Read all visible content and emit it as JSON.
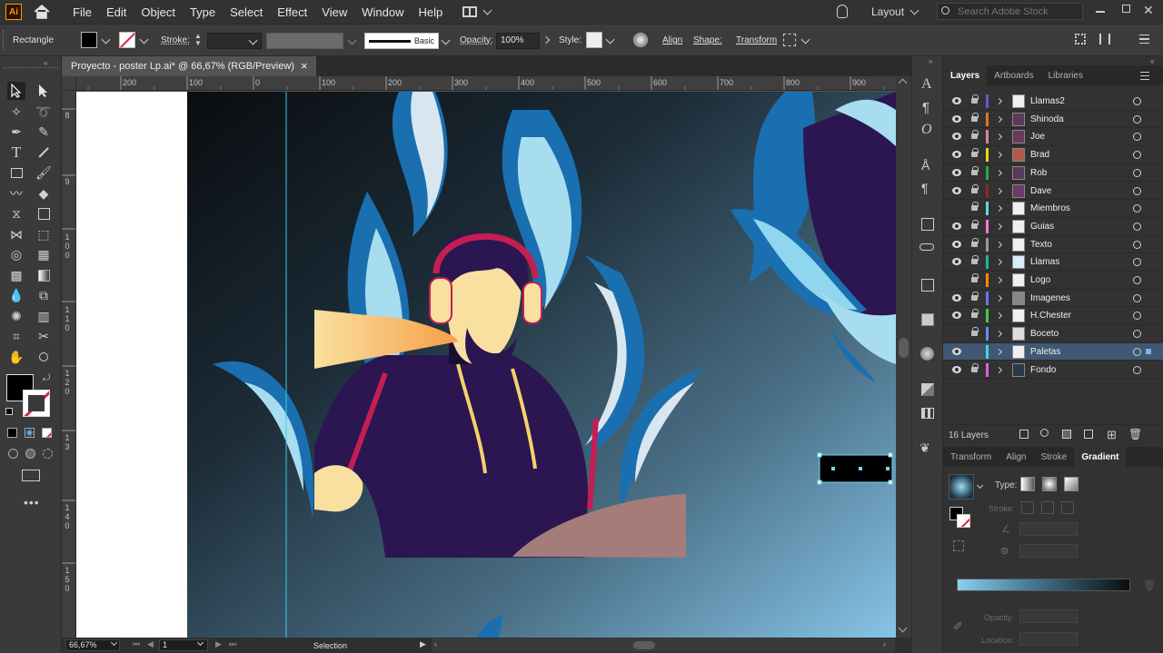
{
  "app": {
    "logo": "Ai",
    "accent": "#ff9a00"
  },
  "menu": [
    "File",
    "Edit",
    "Object",
    "Type",
    "Select",
    "Effect",
    "View",
    "Window",
    "Help"
  ],
  "topright": {
    "workspace": "Layout",
    "search_placeholder": "Search Adobe Stock"
  },
  "control": {
    "tool_name": "Rectangle",
    "stroke_label": "Stroke:",
    "brush_label": "Basic",
    "opacity_label": "Opacity:",
    "opacity_value": "100%",
    "style_label": "Style:",
    "align_label": "Align",
    "shape_label": "Shape:",
    "transform_label": "Transform"
  },
  "document": {
    "tab_title": "Proyecto - poster Lp.ai* @ 66,67% (RGB/Preview)",
    "close": "×"
  },
  "ruler_top": [
    "200",
    "100",
    "0",
    "100",
    "200",
    "300",
    "400",
    "500",
    "600",
    "700",
    "800",
    "900"
  ],
  "ruler_left": [
    [
      "8"
    ],
    [
      "9"
    ],
    [
      "1",
      "0",
      "0"
    ],
    [
      "1",
      "1",
      "0"
    ],
    [
      "1",
      "2",
      "0"
    ],
    [
      "1",
      "3"
    ],
    [
      "1",
      "4",
      "0"
    ],
    [
      "1",
      "5",
      "0"
    ]
  ],
  "status": {
    "zoom": "66,67%",
    "artboard": "1",
    "tool": "Selection"
  },
  "panels": {
    "top_tabs": [
      "Layers",
      "Artboards",
      "Libraries"
    ],
    "layers": [
      {
        "name": "Llamas2",
        "color": "#7a4fd6",
        "eye": true
      },
      {
        "name": "Shinoda",
        "color": "#e07a1f",
        "eye": true
      },
      {
        "name": "Joe",
        "color": "#e080b0",
        "eye": true
      },
      {
        "name": "Brad",
        "color": "#e8d420",
        "eye": true
      },
      {
        "name": "Rob",
        "color": "#2fa84a",
        "eye": true
      },
      {
        "name": "Dave",
        "color": "#8a2a2a",
        "eye": true
      },
      {
        "name": "Miembros",
        "color": "#6ad4e8",
        "eye": false
      },
      {
        "name": "Guias",
        "color": "#ff7ad0",
        "eye": true
      },
      {
        "name": "Texto",
        "color": "#999999",
        "eye": true
      },
      {
        "name": "Llamas",
        "color": "#22b59a",
        "eye": true
      },
      {
        "name": "Logo",
        "color": "#ff8a00",
        "eye": false
      },
      {
        "name": "Imagenes",
        "color": "#6a72ff",
        "eye": true
      },
      {
        "name": "H.Chester",
        "color": "#3acf4a",
        "eye": true
      },
      {
        "name": "Boceto",
        "color": "#6a8cff",
        "eye": false
      },
      {
        "name": "Paletas",
        "color": "#40d4e8",
        "eye": true,
        "selected": true
      },
      {
        "name": "Fondo",
        "color": "#e060e0",
        "eye": true
      }
    ],
    "layer_count": "16 Layers",
    "bottom_tabs": [
      "Transform",
      "Align",
      "Stroke",
      "Gradient"
    ],
    "gradient": {
      "type_label": "Type:",
      "stroke_label": "Stroke:",
      "opacity_label": "Opacity:",
      "location_label": "Location:"
    }
  }
}
